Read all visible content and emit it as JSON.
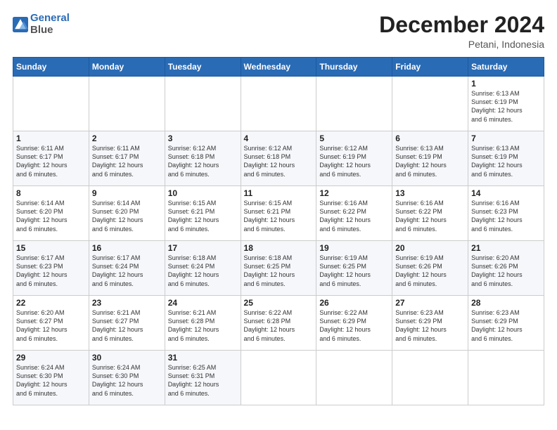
{
  "header": {
    "logo_line1": "General",
    "logo_line2": "Blue",
    "title": "December 2024",
    "subtitle": "Petani, Indonesia"
  },
  "calendar": {
    "days_of_week": [
      "Sunday",
      "Monday",
      "Tuesday",
      "Wednesday",
      "Thursday",
      "Friday",
      "Saturday"
    ],
    "weeks": [
      [
        null,
        null,
        null,
        null,
        null,
        null,
        {
          "day": 1,
          "sunrise": "6:13 AM",
          "sunset": "6:19 PM",
          "daylight": "12 hours and 6 minutes."
        }
      ],
      [
        {
          "day": 1,
          "sunrise": "6:11 AM",
          "sunset": "6:17 PM",
          "daylight": "12 hours and 6 minutes."
        },
        {
          "day": 2,
          "sunrise": "6:11 AM",
          "sunset": "6:17 PM",
          "daylight": "12 hours and 6 minutes."
        },
        {
          "day": 3,
          "sunrise": "6:12 AM",
          "sunset": "6:18 PM",
          "daylight": "12 hours and 6 minutes."
        },
        {
          "day": 4,
          "sunrise": "6:12 AM",
          "sunset": "6:18 PM",
          "daylight": "12 hours and 6 minutes."
        },
        {
          "day": 5,
          "sunrise": "6:12 AM",
          "sunset": "6:19 PM",
          "daylight": "12 hours and 6 minutes."
        },
        {
          "day": 6,
          "sunrise": "6:13 AM",
          "sunset": "6:19 PM",
          "daylight": "12 hours and 6 minutes."
        },
        {
          "day": 7,
          "sunrise": "6:13 AM",
          "sunset": "6:19 PM",
          "daylight": "12 hours and 6 minutes."
        }
      ],
      [
        {
          "day": 8,
          "sunrise": "6:14 AM",
          "sunset": "6:20 PM",
          "daylight": "12 hours and 6 minutes."
        },
        {
          "day": 9,
          "sunrise": "6:14 AM",
          "sunset": "6:20 PM",
          "daylight": "12 hours and 6 minutes."
        },
        {
          "day": 10,
          "sunrise": "6:15 AM",
          "sunset": "6:21 PM",
          "daylight": "12 hours and 6 minutes."
        },
        {
          "day": 11,
          "sunrise": "6:15 AM",
          "sunset": "6:21 PM",
          "daylight": "12 hours and 6 minutes."
        },
        {
          "day": 12,
          "sunrise": "6:16 AM",
          "sunset": "6:22 PM",
          "daylight": "12 hours and 6 minutes."
        },
        {
          "day": 13,
          "sunrise": "6:16 AM",
          "sunset": "6:22 PM",
          "daylight": "12 hours and 6 minutes."
        },
        {
          "day": 14,
          "sunrise": "6:16 AM",
          "sunset": "6:23 PM",
          "daylight": "12 hours and 6 minutes."
        }
      ],
      [
        {
          "day": 15,
          "sunrise": "6:17 AM",
          "sunset": "6:23 PM",
          "daylight": "12 hours and 6 minutes."
        },
        {
          "day": 16,
          "sunrise": "6:17 AM",
          "sunset": "6:24 PM",
          "daylight": "12 hours and 6 minutes."
        },
        {
          "day": 17,
          "sunrise": "6:18 AM",
          "sunset": "6:24 PM",
          "daylight": "12 hours and 6 minutes."
        },
        {
          "day": 18,
          "sunrise": "6:18 AM",
          "sunset": "6:25 PM",
          "daylight": "12 hours and 6 minutes."
        },
        {
          "day": 19,
          "sunrise": "6:19 AM",
          "sunset": "6:25 PM",
          "daylight": "12 hours and 6 minutes."
        },
        {
          "day": 20,
          "sunrise": "6:19 AM",
          "sunset": "6:26 PM",
          "daylight": "12 hours and 6 minutes."
        },
        {
          "day": 21,
          "sunrise": "6:20 AM",
          "sunset": "6:26 PM",
          "daylight": "12 hours and 6 minutes."
        }
      ],
      [
        {
          "day": 22,
          "sunrise": "6:20 AM",
          "sunset": "6:27 PM",
          "daylight": "12 hours and 6 minutes."
        },
        {
          "day": 23,
          "sunrise": "6:21 AM",
          "sunset": "6:27 PM",
          "daylight": "12 hours and 6 minutes."
        },
        {
          "day": 24,
          "sunrise": "6:21 AM",
          "sunset": "6:28 PM",
          "daylight": "12 hours and 6 minutes."
        },
        {
          "day": 25,
          "sunrise": "6:22 AM",
          "sunset": "6:28 PM",
          "daylight": "12 hours and 6 minutes."
        },
        {
          "day": 26,
          "sunrise": "6:22 AM",
          "sunset": "6:29 PM",
          "daylight": "12 hours and 6 minutes."
        },
        {
          "day": 27,
          "sunrise": "6:23 AM",
          "sunset": "6:29 PM",
          "daylight": "12 hours and 6 minutes."
        },
        {
          "day": 28,
          "sunrise": "6:23 AM",
          "sunset": "6:29 PM",
          "daylight": "12 hours and 6 minutes."
        }
      ],
      [
        {
          "day": 29,
          "sunrise": "6:24 AM",
          "sunset": "6:30 PM",
          "daylight": "12 hours and 6 minutes."
        },
        {
          "day": 30,
          "sunrise": "6:24 AM",
          "sunset": "6:30 PM",
          "daylight": "12 hours and 6 minutes."
        },
        {
          "day": 31,
          "sunrise": "6:25 AM",
          "sunset": "6:31 PM",
          "daylight": "12 hours and 6 minutes."
        },
        null,
        null,
        null,
        null
      ]
    ],
    "labels": {
      "sunrise": "Sunrise:",
      "sunset": "Sunset:",
      "daylight": "Daylight:"
    }
  }
}
